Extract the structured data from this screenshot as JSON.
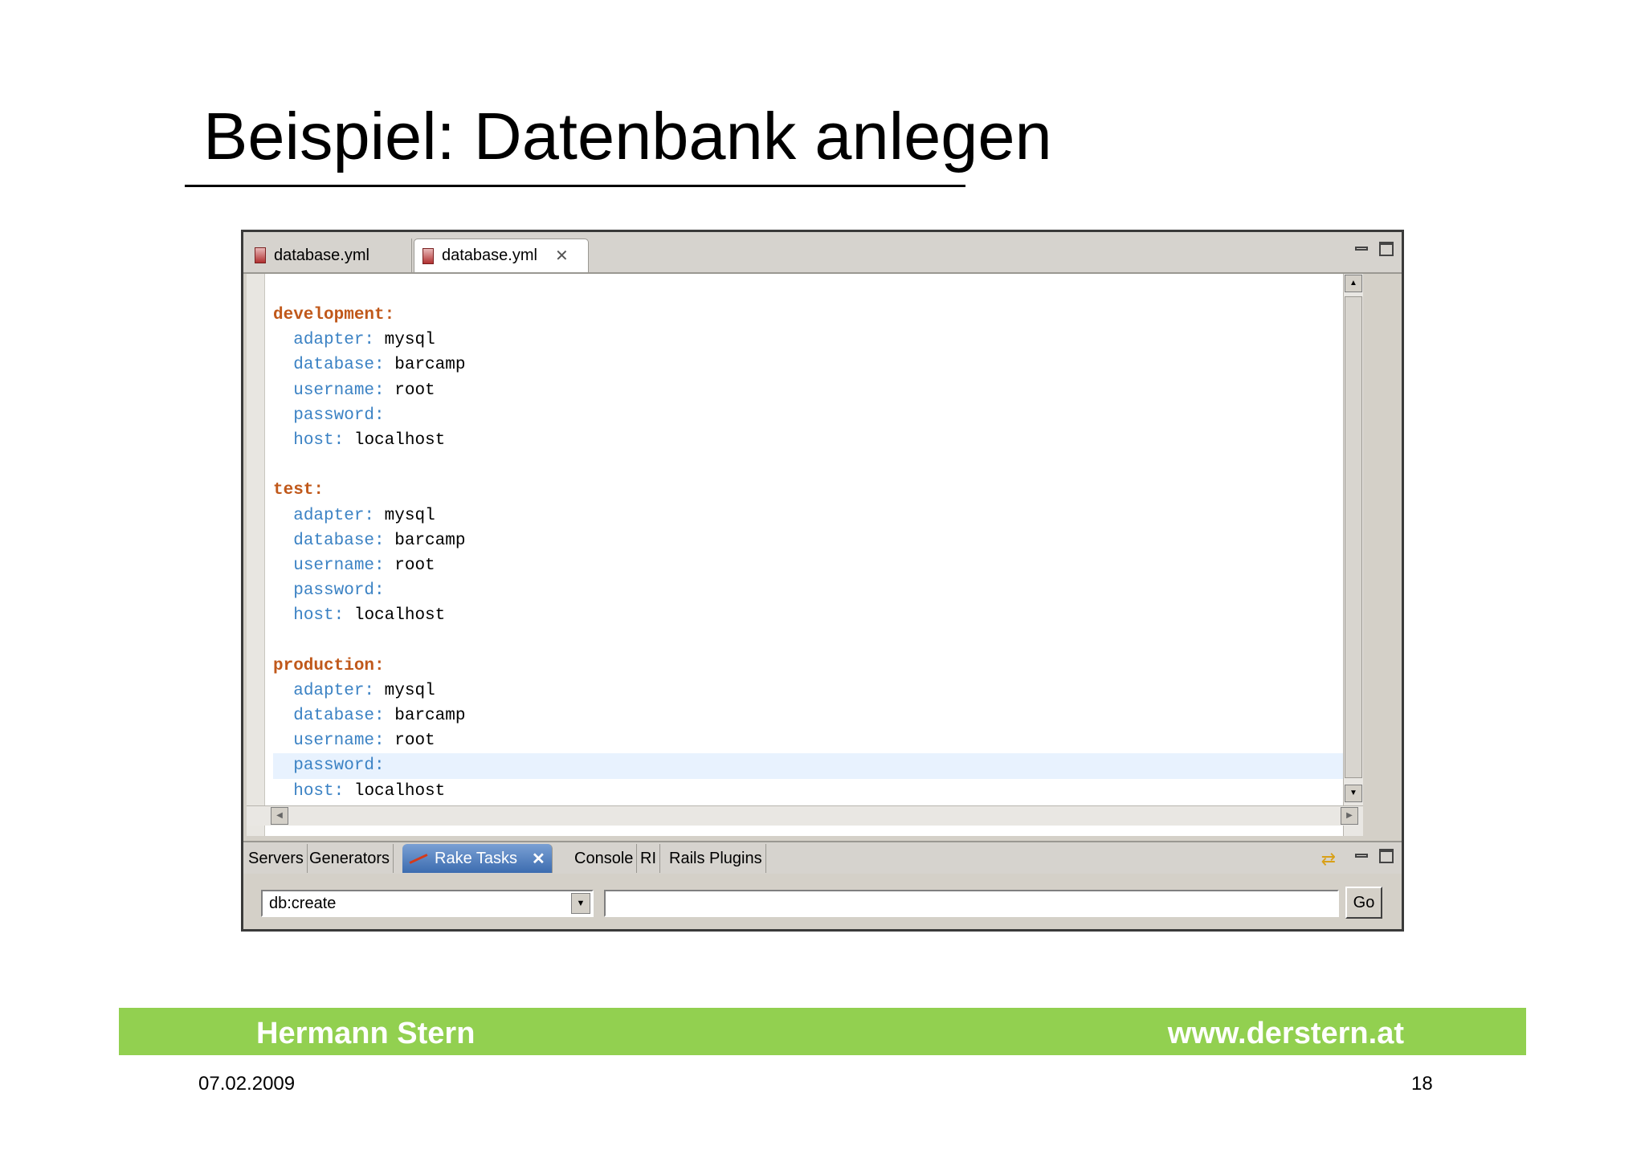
{
  "slide": {
    "title": "Beispiel: Datenbank anlegen",
    "footer_author": "Hermann Stern",
    "footer_url": "www.derstern.at",
    "date": "07.02.2009",
    "page_number": "18"
  },
  "editor": {
    "tabs": [
      {
        "label": "database.yml",
        "active": false
      },
      {
        "label": "database.yml",
        "active": true
      }
    ],
    "close_glyph": "✕",
    "lines": [
      {
        "kind": "top",
        "key": "development:",
        "value": ""
      },
      {
        "kind": "sub",
        "key": "adapter:",
        "value": "mysql"
      },
      {
        "kind": "sub",
        "key": "database:",
        "value": "barcamp"
      },
      {
        "kind": "sub",
        "key": "username:",
        "value": "root"
      },
      {
        "kind": "sub",
        "key": "password:",
        "value": ""
      },
      {
        "kind": "sub",
        "key": "host:",
        "value": "localhost"
      },
      {
        "kind": "blank",
        "key": "",
        "value": ""
      },
      {
        "kind": "top",
        "key": "test:",
        "value": ""
      },
      {
        "kind": "sub",
        "key": "adapter:",
        "value": "mysql"
      },
      {
        "kind": "sub",
        "key": "database:",
        "value": "barcamp"
      },
      {
        "kind": "sub",
        "key": "username:",
        "value": "root"
      },
      {
        "kind": "sub",
        "key": "password:",
        "value": ""
      },
      {
        "kind": "sub",
        "key": "host:",
        "value": "localhost"
      },
      {
        "kind": "blank",
        "key": "",
        "value": ""
      },
      {
        "kind": "top",
        "key": "production:",
        "value": ""
      },
      {
        "kind": "sub",
        "key": "adapter:",
        "value": "mysql"
      },
      {
        "kind": "sub",
        "key": "database:",
        "value": "barcamp"
      },
      {
        "kind": "sub",
        "key": "username:",
        "value": "root"
      },
      {
        "kind": "sub",
        "key": "password:",
        "value": "",
        "highlighted": true
      },
      {
        "kind": "sub",
        "key": "host:",
        "value": "localhost"
      }
    ]
  },
  "views": {
    "tabs": [
      {
        "label": "Servers",
        "active": false
      },
      {
        "label": "Generators",
        "active": false
      },
      {
        "label": "Rake Tasks",
        "active": true
      },
      {
        "label": "Console",
        "active": false
      },
      {
        "label": "RI",
        "active": false
      },
      {
        "label": "Rails Plugins",
        "active": false
      }
    ],
    "task_select_value": "db:create",
    "task_args_value": "",
    "go_label": "Go"
  },
  "colors": {
    "top_key": "#c0581a",
    "sub_key": "#3b82c4",
    "footer_bar": "#92d050",
    "active_view_tab": "#3c6cb0",
    "line_highlight": "#e8f2fe"
  },
  "icons": [
    "yml-file-icon",
    "close-icon",
    "minimize-icon",
    "maximize-icon",
    "scroll-up-arrow-icon",
    "scroll-down-arrow-icon",
    "scroll-left-arrow-icon",
    "scroll-right-arrow-icon",
    "rake-icon",
    "sync-icon",
    "dropdown-arrow-icon"
  ]
}
